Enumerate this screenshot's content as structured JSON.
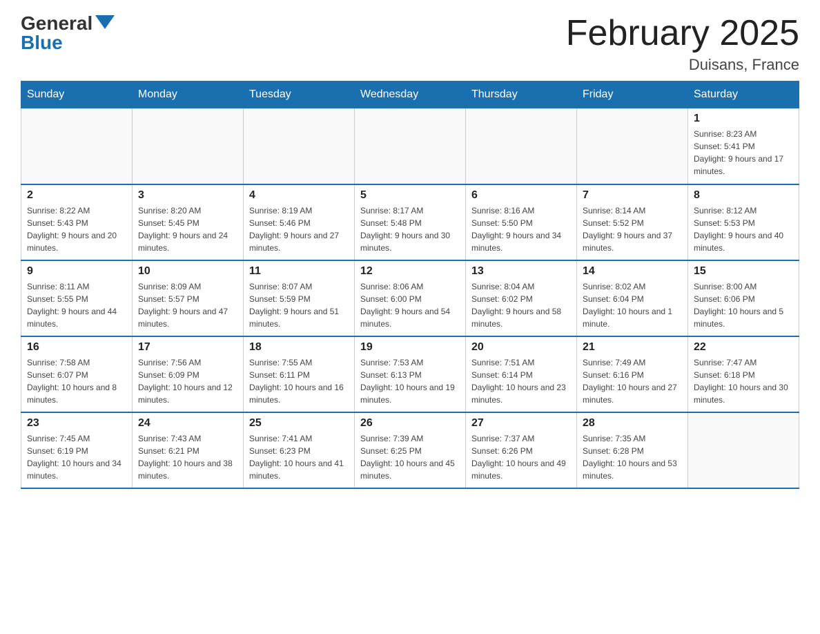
{
  "logo": {
    "general": "General",
    "blue": "Blue"
  },
  "header": {
    "title": "February 2025",
    "subtitle": "Duisans, France"
  },
  "days_of_week": [
    "Sunday",
    "Monday",
    "Tuesday",
    "Wednesday",
    "Thursday",
    "Friday",
    "Saturday"
  ],
  "weeks": [
    [
      {
        "day": "",
        "info": ""
      },
      {
        "day": "",
        "info": ""
      },
      {
        "day": "",
        "info": ""
      },
      {
        "day": "",
        "info": ""
      },
      {
        "day": "",
        "info": ""
      },
      {
        "day": "",
        "info": ""
      },
      {
        "day": "1",
        "info": "Sunrise: 8:23 AM\nSunset: 5:41 PM\nDaylight: 9 hours and 17 minutes."
      }
    ],
    [
      {
        "day": "2",
        "info": "Sunrise: 8:22 AM\nSunset: 5:43 PM\nDaylight: 9 hours and 20 minutes."
      },
      {
        "day": "3",
        "info": "Sunrise: 8:20 AM\nSunset: 5:45 PM\nDaylight: 9 hours and 24 minutes."
      },
      {
        "day": "4",
        "info": "Sunrise: 8:19 AM\nSunset: 5:46 PM\nDaylight: 9 hours and 27 minutes."
      },
      {
        "day": "5",
        "info": "Sunrise: 8:17 AM\nSunset: 5:48 PM\nDaylight: 9 hours and 30 minutes."
      },
      {
        "day": "6",
        "info": "Sunrise: 8:16 AM\nSunset: 5:50 PM\nDaylight: 9 hours and 34 minutes."
      },
      {
        "day": "7",
        "info": "Sunrise: 8:14 AM\nSunset: 5:52 PM\nDaylight: 9 hours and 37 minutes."
      },
      {
        "day": "8",
        "info": "Sunrise: 8:12 AM\nSunset: 5:53 PM\nDaylight: 9 hours and 40 minutes."
      }
    ],
    [
      {
        "day": "9",
        "info": "Sunrise: 8:11 AM\nSunset: 5:55 PM\nDaylight: 9 hours and 44 minutes."
      },
      {
        "day": "10",
        "info": "Sunrise: 8:09 AM\nSunset: 5:57 PM\nDaylight: 9 hours and 47 minutes."
      },
      {
        "day": "11",
        "info": "Sunrise: 8:07 AM\nSunset: 5:59 PM\nDaylight: 9 hours and 51 minutes."
      },
      {
        "day": "12",
        "info": "Sunrise: 8:06 AM\nSunset: 6:00 PM\nDaylight: 9 hours and 54 minutes."
      },
      {
        "day": "13",
        "info": "Sunrise: 8:04 AM\nSunset: 6:02 PM\nDaylight: 9 hours and 58 minutes."
      },
      {
        "day": "14",
        "info": "Sunrise: 8:02 AM\nSunset: 6:04 PM\nDaylight: 10 hours and 1 minute."
      },
      {
        "day": "15",
        "info": "Sunrise: 8:00 AM\nSunset: 6:06 PM\nDaylight: 10 hours and 5 minutes."
      }
    ],
    [
      {
        "day": "16",
        "info": "Sunrise: 7:58 AM\nSunset: 6:07 PM\nDaylight: 10 hours and 8 minutes."
      },
      {
        "day": "17",
        "info": "Sunrise: 7:56 AM\nSunset: 6:09 PM\nDaylight: 10 hours and 12 minutes."
      },
      {
        "day": "18",
        "info": "Sunrise: 7:55 AM\nSunset: 6:11 PM\nDaylight: 10 hours and 16 minutes."
      },
      {
        "day": "19",
        "info": "Sunrise: 7:53 AM\nSunset: 6:13 PM\nDaylight: 10 hours and 19 minutes."
      },
      {
        "day": "20",
        "info": "Sunrise: 7:51 AM\nSunset: 6:14 PM\nDaylight: 10 hours and 23 minutes."
      },
      {
        "day": "21",
        "info": "Sunrise: 7:49 AM\nSunset: 6:16 PM\nDaylight: 10 hours and 27 minutes."
      },
      {
        "day": "22",
        "info": "Sunrise: 7:47 AM\nSunset: 6:18 PM\nDaylight: 10 hours and 30 minutes."
      }
    ],
    [
      {
        "day": "23",
        "info": "Sunrise: 7:45 AM\nSunset: 6:19 PM\nDaylight: 10 hours and 34 minutes."
      },
      {
        "day": "24",
        "info": "Sunrise: 7:43 AM\nSunset: 6:21 PM\nDaylight: 10 hours and 38 minutes."
      },
      {
        "day": "25",
        "info": "Sunrise: 7:41 AM\nSunset: 6:23 PM\nDaylight: 10 hours and 41 minutes."
      },
      {
        "day": "26",
        "info": "Sunrise: 7:39 AM\nSunset: 6:25 PM\nDaylight: 10 hours and 45 minutes."
      },
      {
        "day": "27",
        "info": "Sunrise: 7:37 AM\nSunset: 6:26 PM\nDaylight: 10 hours and 49 minutes."
      },
      {
        "day": "28",
        "info": "Sunrise: 7:35 AM\nSunset: 6:28 PM\nDaylight: 10 hours and 53 minutes."
      },
      {
        "day": "",
        "info": ""
      }
    ]
  ]
}
